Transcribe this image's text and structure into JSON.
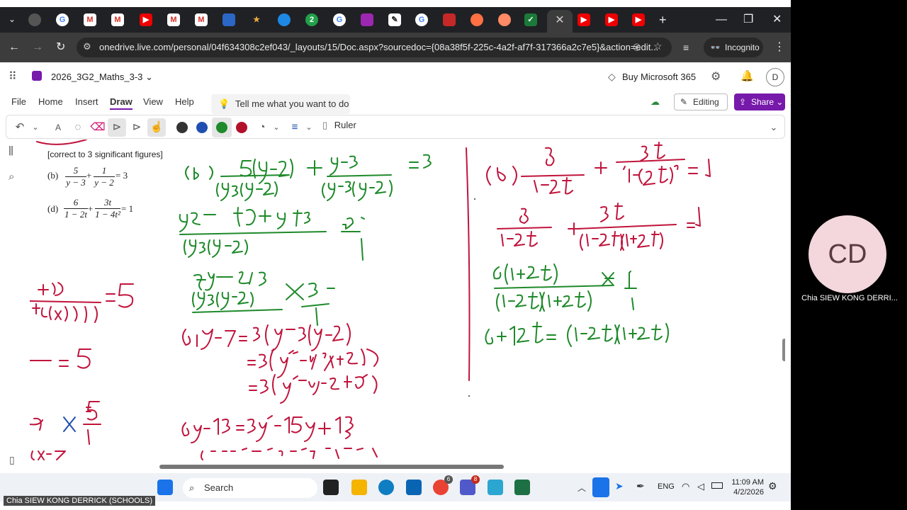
{
  "browser": {
    "url": "onedrive.live.com/personal/04f634308c2ef043/_layouts/15/Doc.aspx?sourcedoc={08a38f5f-225c-4a2f-af7f-317366a2c7e5}&action=edit...",
    "incognito_label": "Incognito",
    "tab_badge": "2",
    "close_tab_glyph": "✕",
    "new_tab_glyph": "+"
  },
  "app": {
    "notebook_title": "2026_3G2_Maths_3-3",
    "buy_label": "Buy Microsoft 365",
    "editing_label": "Editing",
    "share_label": "Share",
    "user_initial": "D"
  },
  "ribbon": {
    "tabs": [
      "File",
      "Home",
      "Insert",
      "Draw",
      "View",
      "Help"
    ],
    "active_tab": "Draw",
    "tell_me_placeholder": "Tell me what you want to do",
    "ruler_label": "Ruler",
    "pen_colors": [
      "#333333",
      "#1f4fb0",
      "#1e8a2a",
      "#b3102c"
    ]
  },
  "page": {
    "instruction": "[correct to 3 significant figures]",
    "question_b_label": "(b)",
    "question_d_label": "(d)",
    "qb_t1_num": "5",
    "qb_t1_den": "y − 3",
    "qb_t2_num": "1",
    "qb_t2_den": "y − 2",
    "qb_rhs": "= 3",
    "qd_t1_num": "6",
    "qd_t1_den": "1 − 2t",
    "qd_t2_num": "3t",
    "qd_t2_den": "1 − 4t²",
    "qd_rhs": "= 1",
    "plus": "+"
  },
  "taskbar": {
    "search_placeholder": "Search",
    "language": "ENG",
    "time": "11:09 AM",
    "date": "4/2/2026",
    "teams_badge": "8",
    "chrome_badge": "6"
  },
  "call": {
    "avatar_initials": "CD",
    "participant_name": "Chia SIEW KONG DERRI...",
    "presenter_label": "Chia SIEW KONG DERRICK (SCHOOLS)"
  }
}
